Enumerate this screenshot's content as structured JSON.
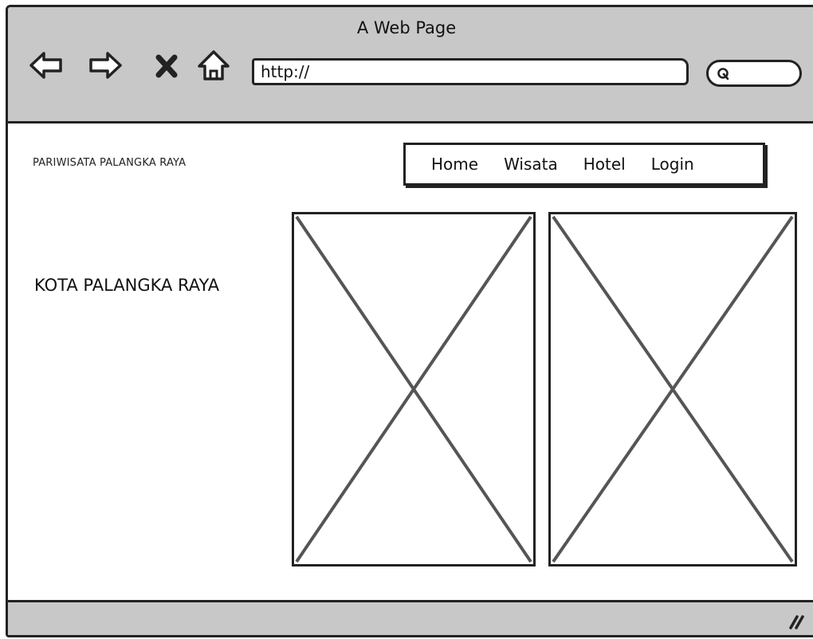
{
  "browser": {
    "title": "A Web Page",
    "url": "http://",
    "nav_icons": [
      "back-arrow-icon",
      "forward-arrow-icon",
      "stop-icon",
      "home-icon"
    ],
    "search_icon": "search-icon"
  },
  "site": {
    "name": "PARIWISATA PALANGKA RAYA",
    "menu": [
      {
        "label": "Home"
      },
      {
        "label": "Wisata"
      },
      {
        "label": "Hotel"
      },
      {
        "label": "Login"
      }
    ],
    "heading": "KOTA PALANGKA RAYA",
    "images": [
      "image-placeholder",
      "image-placeholder"
    ]
  },
  "colors": {
    "chrome": "#c8c8c8",
    "stroke": "#222222",
    "placeholder_cross": "#555555"
  }
}
